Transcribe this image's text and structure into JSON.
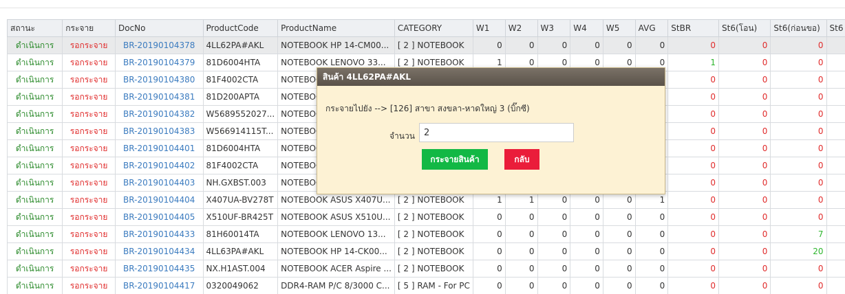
{
  "table": {
    "headers": [
      "สถานะ",
      "กระจาย",
      "DocNo",
      "ProductCode",
      "ProductName",
      "CATEGORY",
      "W1",
      "W2",
      "W3",
      "W4",
      "W5",
      "AVG",
      "StBR",
      "St6(โอน)",
      "St6(ก่อนขอ)",
      "St6"
    ],
    "rows": [
      {
        "status": "ดำเนินการ",
        "dist": "รอกระจาย",
        "doc": "BR-20190104378",
        "code": "4LL62PA#AKL",
        "name": "NOTEBOOK HP 14-CM00...",
        "cat": "[ 2 ] NOTEBOOK",
        "w1": "0",
        "w2": "0",
        "w3": "0",
        "w4": "0",
        "w5": "0",
        "avg": "0",
        "stbr": "0",
        "st6o": "0",
        "st6k": "0",
        "stbr_color": "red",
        "st6k_color": "red"
      },
      {
        "status": "ดำเนินการ",
        "dist": "รอกระจาย",
        "doc": "BR-20190104379",
        "code": "81D6004HTA",
        "name": "NOTEBOOK LENOVO 33...",
        "cat": "[ 2 ] NOTEBOOK",
        "w1": "1",
        "w2": "0",
        "w3": "0",
        "w4": "0",
        "w5": "0",
        "avg": "0",
        "stbr": "1",
        "st6o": "0",
        "st6k": "0",
        "stbr_color": "green",
        "st6k_color": "red"
      },
      {
        "status": "ดำเนินการ",
        "dist": "รอกระจาย",
        "doc": "BR-20190104380",
        "code": "81F4002CTA",
        "name": "NOTEBOOK",
        "cat": "",
        "w1": "",
        "w2": "",
        "w3": "",
        "w4": "",
        "w5": "",
        "avg": "",
        "stbr": "0",
        "st6o": "0",
        "st6k": "0",
        "stbr_color": "red",
        "st6k_color": "red"
      },
      {
        "status": "ดำเนินการ",
        "dist": "รอกระจาย",
        "doc": "BR-20190104381",
        "code": "81D200APTA",
        "name": "NOTEBOOK",
        "cat": "",
        "w1": "",
        "w2": "",
        "w3": "",
        "w4": "",
        "w5": "",
        "avg": "",
        "stbr": "0",
        "st6o": "0",
        "st6k": "0",
        "stbr_color": "red",
        "st6k_color": "red"
      },
      {
        "status": "ดำเนินการ",
        "dist": "รอกระจาย",
        "doc": "BR-20190104382",
        "code": "W5689552027...",
        "name": "NOTEBOOK",
        "cat": "",
        "w1": "",
        "w2": "",
        "w3": "",
        "w4": "",
        "w5": "",
        "avg": "",
        "stbr": "0",
        "st6o": "0",
        "st6k": "0",
        "stbr_color": "red",
        "st6k_color": "red"
      },
      {
        "status": "ดำเนินการ",
        "dist": "รอกระจาย",
        "doc": "BR-20190104383",
        "code": "W566914115T...",
        "name": "NOTEBOOK",
        "cat": "",
        "w1": "",
        "w2": "",
        "w3": "",
        "w4": "",
        "w5": "",
        "avg": "",
        "stbr": "0",
        "st6o": "0",
        "st6k": "0",
        "stbr_color": "red",
        "st6k_color": "red"
      },
      {
        "status": "ดำเนินการ",
        "dist": "รอกระจาย",
        "doc": "BR-20190104401",
        "code": "81D6004HTA",
        "name": "NOTEBOOK",
        "cat": "",
        "w1": "",
        "w2": "",
        "w3": "",
        "w4": "",
        "w5": "",
        "avg": "",
        "stbr": "0",
        "st6o": "0",
        "st6k": "0",
        "stbr_color": "red",
        "st6k_color": "red"
      },
      {
        "status": "ดำเนินการ",
        "dist": "รอกระจาย",
        "doc": "BR-20190104402",
        "code": "81F4002CTA",
        "name": "NOTEBOOK",
        "cat": "",
        "w1": "",
        "w2": "",
        "w3": "",
        "w4": "",
        "w5": "",
        "avg": "",
        "stbr": "0",
        "st6o": "0",
        "st6k": "0",
        "stbr_color": "red",
        "st6k_color": "red"
      },
      {
        "status": "ดำเนินการ",
        "dist": "รอกระจาย",
        "doc": "BR-20190104403",
        "code": "NH.GXBST.003",
        "name": "NOTEBOOK",
        "cat": "",
        "w1": "",
        "w2": "",
        "w3": "",
        "w4": "",
        "w5": "",
        "avg": "",
        "stbr": "0",
        "st6o": "0",
        "st6k": "0",
        "stbr_color": "red",
        "st6k_color": "red"
      },
      {
        "status": "ดำเนินการ",
        "dist": "รอกระจาย",
        "doc": "BR-20190104404",
        "code": "X407UA-BV278T",
        "name": "NOTEBOOK ASUS X407U...",
        "cat": "[ 2 ] NOTEBOOK",
        "w1": "1",
        "w2": "1",
        "w3": "0",
        "w4": "0",
        "w5": "0",
        "avg": "1",
        "stbr": "0",
        "st6o": "0",
        "st6k": "0",
        "stbr_color": "red",
        "st6k_color": "red"
      },
      {
        "status": "ดำเนินการ",
        "dist": "รอกระจาย",
        "doc": "BR-20190104405",
        "code": "X510UF-BR425T",
        "name": "NOTEBOOK ASUS X510U...",
        "cat": "[ 2 ] NOTEBOOK",
        "w1": "0",
        "w2": "0",
        "w3": "0",
        "w4": "0",
        "w5": "0",
        "avg": "0",
        "stbr": "0",
        "st6o": "0",
        "st6k": "0",
        "stbr_color": "red",
        "st6k_color": "red"
      },
      {
        "status": "ดำเนินการ",
        "dist": "รอกระจาย",
        "doc": "BR-20190104433",
        "code": "81H60014TA",
        "name": "NOTEBOOK LENOVO 13...",
        "cat": "[ 2 ] NOTEBOOK",
        "w1": "0",
        "w2": "0",
        "w3": "0",
        "w4": "0",
        "w5": "0",
        "avg": "0",
        "stbr": "0",
        "st6o": "0",
        "st6k": "7",
        "stbr_color": "red",
        "st6k_color": "green"
      },
      {
        "status": "ดำเนินการ",
        "dist": "รอกระจาย",
        "doc": "BR-20190104434",
        "code": "4LL63PA#AKL",
        "name": "NOTEBOOK HP 14-CK00...",
        "cat": "[ 2 ] NOTEBOOK",
        "w1": "0",
        "w2": "0",
        "w3": "0",
        "w4": "0",
        "w5": "0",
        "avg": "0",
        "stbr": "0",
        "st6o": "0",
        "st6k": "20",
        "stbr_color": "red",
        "st6k_color": "green"
      },
      {
        "status": "ดำเนินการ",
        "dist": "รอกระจาย",
        "doc": "BR-20190104435",
        "code": "NX.H1AST.004",
        "name": "NOTEBOOK ACER Aspire ...",
        "cat": "[ 2 ] NOTEBOOK",
        "w1": "0",
        "w2": "0",
        "w3": "0",
        "w4": "0",
        "w5": "0",
        "avg": "0",
        "stbr": "0",
        "st6o": "0",
        "st6k": "0",
        "stbr_color": "red",
        "st6k_color": "red"
      },
      {
        "status": "ดำเนินการ",
        "dist": "รอกระจาย",
        "doc": "BR-20190104417",
        "code": "0320049062",
        "name": "DDR4-RAM P/C 8/3000 C...",
        "cat": "[ 5 ] RAM - For PC",
        "w1": "0",
        "w2": "0",
        "w3": "0",
        "w4": "0",
        "w5": "0",
        "avg": "0",
        "stbr": "0",
        "st6o": "0",
        "st6k": "0",
        "stbr_color": "red",
        "st6k_color": "red"
      }
    ]
  },
  "dialog": {
    "title": "สินค้า 4LL62PA#AKL",
    "message": "กระจายไปยัง --> [126] สาขา สงขลา-หาดใหญ่ 3 (บิ๊กซี)",
    "qty_label": "จำนวน",
    "qty_value": "2",
    "distribute_label": "กระจายสินค้า",
    "back_label": "กลับ"
  },
  "colors": {
    "green": "#2db52d",
    "red": "#e02b2b",
    "link": "#3b7bbf",
    "dialog_bg": "#fdf2d4"
  }
}
